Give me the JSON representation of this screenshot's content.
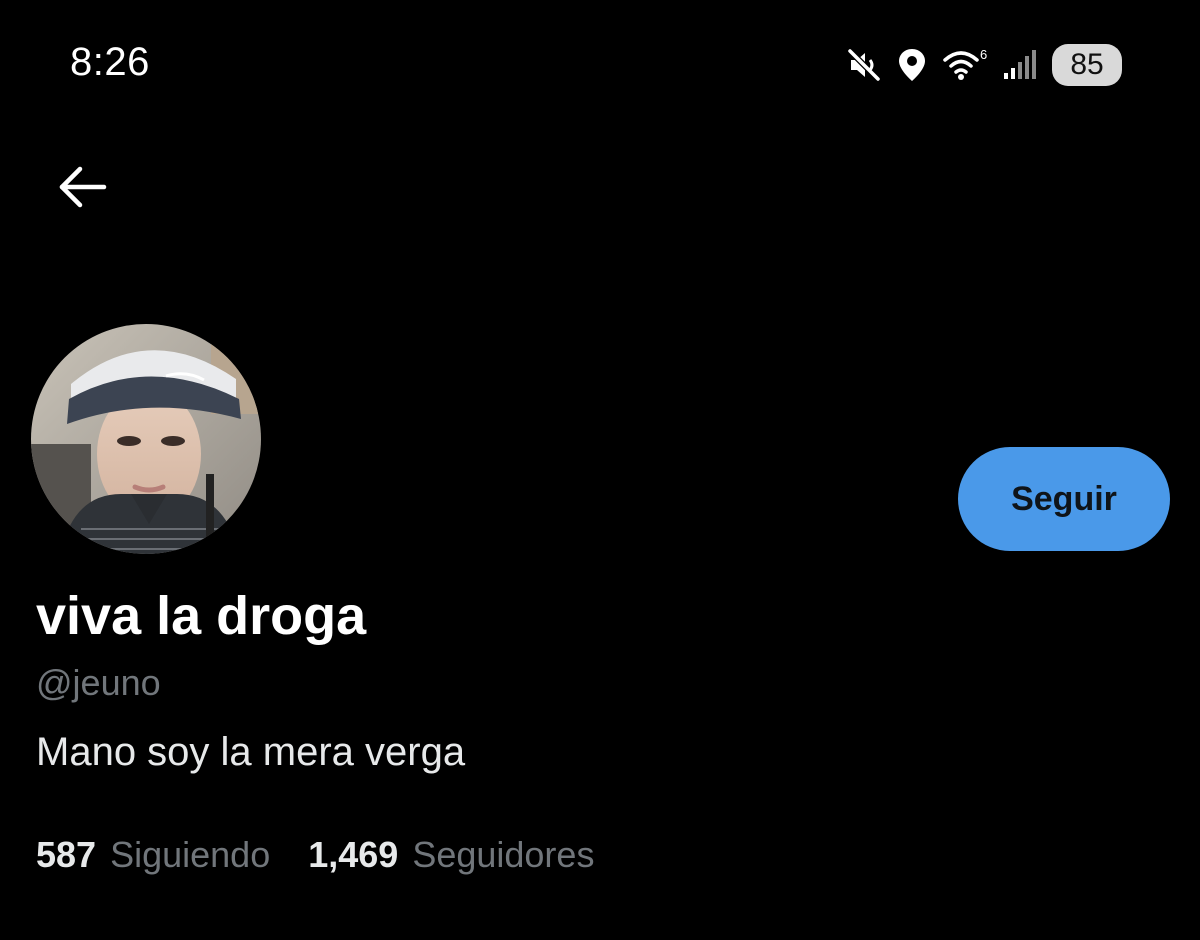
{
  "status_bar": {
    "time": "8:26",
    "battery": "85",
    "wifi_label": "6",
    "icons": [
      "mute-icon",
      "location-icon",
      "wifi-icon",
      "signal-icon",
      "battery-icon"
    ]
  },
  "profile": {
    "display_name": "viva la droga",
    "handle": "@jeuno",
    "bio": "Mano soy la mera verga",
    "follow_label": "Seguir",
    "following_count": "587",
    "following_label": "Siguiendo",
    "followers_count": "1,469",
    "followers_label": "Seguidores"
  },
  "colors": {
    "background": "#000000",
    "accent": "#4a99e9",
    "secondary_text": "#71767b",
    "primary_text": "#e7e9ea"
  }
}
